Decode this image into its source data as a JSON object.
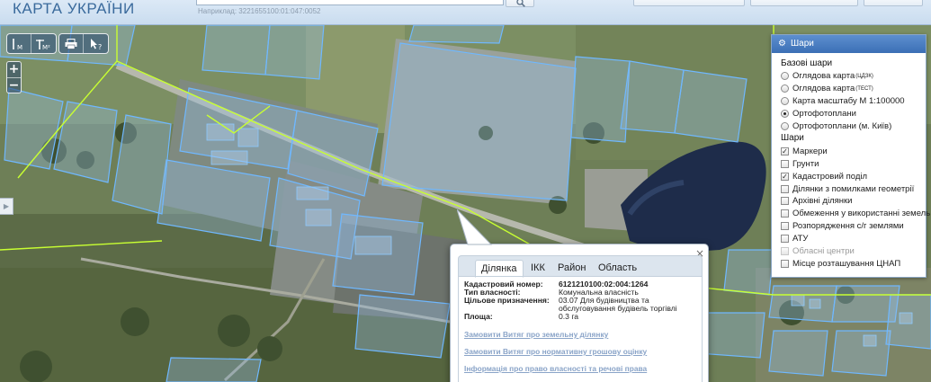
{
  "header": {
    "title": "КАРТА УКРАЇНИ",
    "search": {
      "value": "",
      "hint": "Наприклад: 3221655100:01:047:0052"
    }
  },
  "toolbar": {
    "length_tool": "I M",
    "area_tool": "I M²",
    "print_icon": "printer-icon",
    "identify_icon": "cursor-question-icon",
    "zoom_in": "+",
    "zoom_out": "−"
  },
  "layers": {
    "title": "Шари",
    "base_title": "Базові шари",
    "base": [
      {
        "label": "Оглядова карта",
        "sup": "(ЦДЗК)",
        "selected": false
      },
      {
        "label": "Оглядова карта",
        "sup": "(ТЕСТ)",
        "selected": false
      },
      {
        "label": "Карта масштабу М 1:100000",
        "sup": "",
        "selected": false
      },
      {
        "label": "Ортофотоплани",
        "sup": "",
        "selected": true
      },
      {
        "label": "Ортофотоплани (м. Київ)",
        "sup": "",
        "selected": false
      }
    ],
    "overlay_title": "Шари",
    "overlays": [
      {
        "label": "Маркери",
        "checked": true,
        "enabled": true
      },
      {
        "label": "Грунти",
        "checked": false,
        "enabled": true
      },
      {
        "label": "Кадастровий поділ",
        "checked": true,
        "enabled": true
      },
      {
        "label": "Ділянки з помилками геометрії",
        "checked": false,
        "enabled": true
      },
      {
        "label": "Архівні ділянки",
        "checked": false,
        "enabled": true
      },
      {
        "label": "Обмеження у використанні земель",
        "checked": false,
        "enabled": true
      },
      {
        "label": "Розпорядження с/г землями",
        "checked": false,
        "enabled": true
      },
      {
        "label": "АТУ",
        "checked": false,
        "enabled": true
      },
      {
        "label": "Обласні центри",
        "checked": false,
        "enabled": false
      },
      {
        "label": "Місце розташування ЦНАП",
        "checked": false,
        "enabled": true
      }
    ]
  },
  "popup": {
    "close": "×",
    "tabs": [
      "Ділянка",
      "ІКК",
      "Район",
      "Область"
    ],
    "active_tab": "Ділянка",
    "fields": {
      "cadastral_label": "Кадастровий номер:",
      "cadastral_value": "6121210100:02:004:1264",
      "ownership_label": "Тип власності:",
      "ownership_value": "Комунальна власність",
      "purpose_label": "Цільове призначення:",
      "purpose_value": "03.07 Для будівництва та обслуговування будівель торгівлі",
      "area_label": "Площа:",
      "area_value": "0.3 га"
    },
    "links": [
      "Замовити Витяг про земельну ділянку",
      "Замовити Витяг про нормативну грошову оцінку",
      "Інформація про право власності та речові права"
    ]
  },
  "colors": {
    "header_text": "#3a6a9c",
    "parcel_outline": "#6fb8ff",
    "boundary_line": "#c8ff32",
    "panel_header": "#3b6fb5",
    "link": "#8aa4c8"
  }
}
